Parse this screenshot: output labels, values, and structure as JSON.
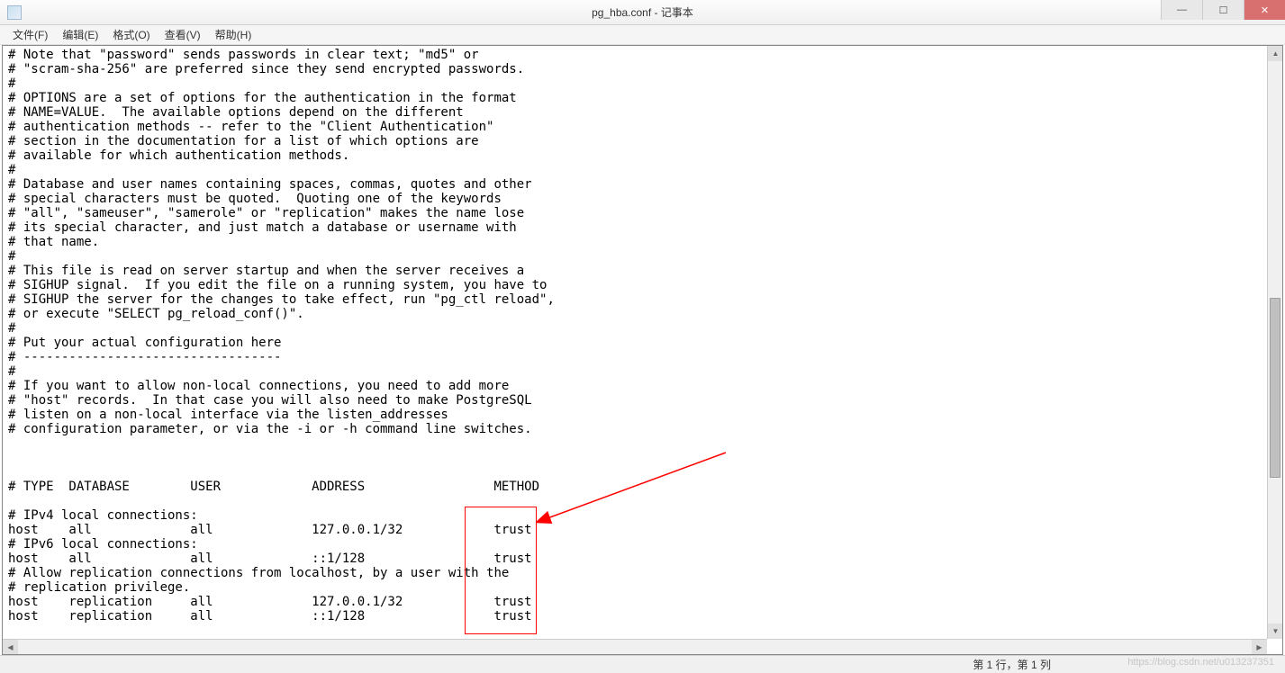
{
  "window": {
    "title": "pg_hba.conf - 记事本",
    "minimize": "—",
    "maximize": "☐",
    "close": "✕"
  },
  "menu": {
    "file": "文件(F)",
    "edit": "编辑(E)",
    "format": "格式(O)",
    "view": "查看(V)",
    "help": "帮助(H)"
  },
  "content": "# Note that \"password\" sends passwords in clear text; \"md5\" or\n# \"scram-sha-256\" are preferred since they send encrypted passwords.\n#\n# OPTIONS are a set of options for the authentication in the format\n# NAME=VALUE.  The available options depend on the different\n# authentication methods -- refer to the \"Client Authentication\"\n# section in the documentation for a list of which options are\n# available for which authentication methods.\n#\n# Database and user names containing spaces, commas, quotes and other\n# special characters must be quoted.  Quoting one of the keywords\n# \"all\", \"sameuser\", \"samerole\" or \"replication\" makes the name lose\n# its special character, and just match a database or username with\n# that name.\n#\n# This file is read on server startup and when the server receives a\n# SIGHUP signal.  If you edit the file on a running system, you have to\n# SIGHUP the server for the changes to take effect, run \"pg_ctl reload\",\n# or execute \"SELECT pg_reload_conf()\".\n#\n# Put your actual configuration here\n# ----------------------------------\n#\n# If you want to allow non-local connections, you need to add more\n# \"host\" records.  In that case you will also need to make PostgreSQL\n# listen on a non-local interface via the listen_addresses\n# configuration parameter, or via the -i or -h command line switches.\n\n\n\n# TYPE  DATABASE        USER            ADDRESS                 METHOD\n\n# IPv4 local connections:\nhost    all             all             127.0.0.1/32            trust\n# IPv6 local connections:\nhost    all             all             ::1/128                 trust\n# Allow replication connections from localhost, by a user with the\n# replication privilege.\nhost    replication     all             127.0.0.1/32            trust\nhost    replication     all             ::1/128                 trust\n",
  "status": {
    "position": "第 1 行，第 1 列"
  },
  "watermark": "https://blog.csdn.net/u013237351"
}
